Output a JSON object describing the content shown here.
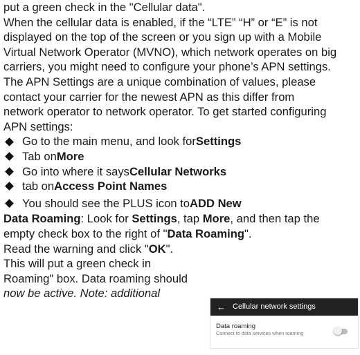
{
  "doc": {
    "intro_lines": [
      "put a green check in the \"Cellular data\".",
      "When the cellular data is enabled, if the “LTE” “H” or “E” is not",
      "displayed on the top of the screen or you sign up with a Mobile",
      "Virtual Network Operator (MVNO), which network operates on big",
      "carriers, you might need to configure your phone’s APN settings.",
      "The APN Settings are a unique combination of values, please",
      "contact your carrier for the newest APN as this differ from",
      "network operator to network operator. To get started configuring",
      "APN settings:"
    ],
    "bullets": [
      {
        "pre": "Go to the main menu, and look for ",
        "bold": "Settings"
      },
      {
        "pre": "Tab on ",
        "bold": "More"
      },
      {
        "pre": "Go into where it says ",
        "bold": "Cellular Networks"
      },
      {
        "pre": "tab on ",
        "bold": "Access Point Names"
      },
      {
        "pre": "You should see the PLUS icon to ",
        "bold": "ADD New"
      }
    ],
    "roaming": {
      "label": "Data Roaming",
      "t1": ": Look for ",
      "b1": "Settings",
      "t2": ", tap ",
      "b2": "More",
      "t3": ", and then tap the",
      "l2_pre": "empty check box to the right of \"",
      "l2_bold": "Data Roaming",
      "l2_post": "\".",
      "l3_pre": "Read the  warning and click \"",
      "l3_bold": "OK",
      "l3_post": "\".",
      "l4": "This will put a green check in",
      "l5": "Roaming\" box. Data roaming should",
      "l6": "now be active. Note: additional"
    }
  },
  "phone": {
    "header_title": "Cellular network settings",
    "back_glyph": "←",
    "setting_title": "Data roaming",
    "setting_subtitle": "Connect to data services when roaming",
    "toggle_on": false
  }
}
